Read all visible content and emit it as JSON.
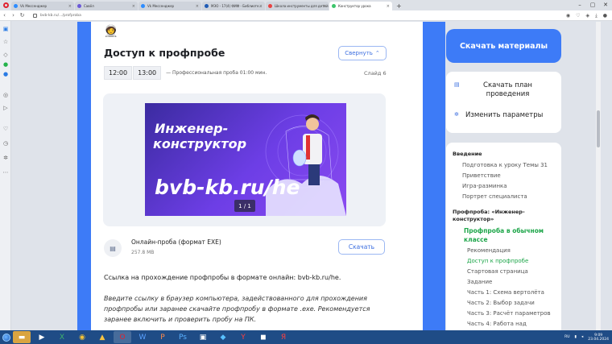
{
  "browser": {
    "tabs": [
      {
        "label": "Vk Мессенджер",
        "active": false,
        "color": "#2d8cff"
      },
      {
        "label": "Савёл",
        "active": false,
        "color": "#6b59d8"
      },
      {
        "label": "Vk Мессенджер",
        "active": false,
        "color": "#2d8cff"
      },
      {
        "label": "МЭО - 17(4) ФИФ - Библиоте...",
        "active": false,
        "color": "#1f5bb5"
      },
      {
        "label": "Школа инструменты для детей",
        "active": false,
        "color": "#e94242"
      },
      {
        "label": "Конструктор урока",
        "active": true,
        "color": "#3cc56b"
      }
    ],
    "url": "bvb-kb.ru/.../profproba",
    "new_tab": "+",
    "controls": [
      "–",
      "▢",
      "✕"
    ]
  },
  "lesson": {
    "emoji": "🧑‍🚀",
    "title": "Доступ к профпробе",
    "collapse_label": "Свернуть",
    "time_start": "12:00",
    "time_end": "13:00",
    "duration_text": "— Профессиональная проба 01:00 мин.",
    "slide_label": "Слайд 6",
    "banner": {
      "line1": "Инженер-",
      "line2": "конструктор",
      "url": "bvb-kb.ru/he",
      "pager": "1 / 1"
    },
    "file": {
      "name": "Онлайн-проба (формат EXE)",
      "size": "257.8 MB",
      "download_label": "Скачать"
    },
    "paragraph1": "Ссылка на прохождение профпробы в формате онлайн: bvb-kb.ru/he.",
    "paragraph2": "Введите ссылку в браузер компьютера, задействованного для прохождения профпробы или заранее скачайте профпробу в формате .exe. Рекомендуется заранее включить и проверить пробу на ПК."
  },
  "right": {
    "download_materials": "Скачать материалы",
    "download_plan": "Скачать план проведения",
    "change_params": "Изменить параметры",
    "toc": {
      "intro_header": "Введение",
      "intro_items": [
        "Подготовка к уроку Темы 31",
        "Приветствие",
        "Игра-разминка",
        "Портрет специалиста"
      ],
      "probe_header_1": "Профпроба: «Инженер-",
      "probe_header_2": "конструктор»",
      "class_header_1": "Профпроба в обычном",
      "class_header_2": "классе",
      "class_items": [
        "Рекомендация",
        "Доступ к профпробе",
        "Стартовая страница",
        "Задание",
        "Часть 1: Схема вертолёта",
        "Часть 2: Выбор задачи",
        "Часть 3: Расчёт параметров",
        "Часть 4: Работа над"
      ]
    }
  },
  "taskbar": {
    "tray_lang": "RU",
    "time": "9:09",
    "date": "23.04.2024"
  },
  "colors": {
    "accent": "#3d7bf7",
    "active_green": "#1ea64a"
  }
}
